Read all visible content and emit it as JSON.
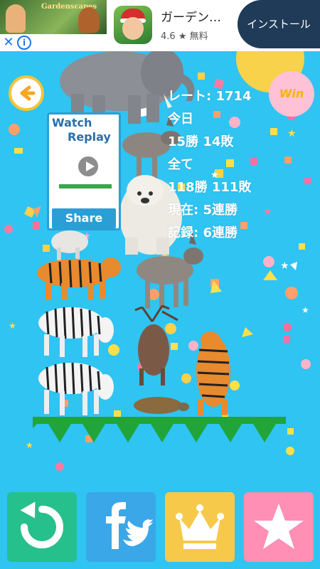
{
  "ad": {
    "thumb_title": "Gardenscapes",
    "app_title": "ガーデン…",
    "rating": "4.6",
    "rating_star": "★",
    "price": "無料",
    "install_label": "インストール",
    "close_glyph": "✕",
    "info_glyph": "i"
  },
  "game": {
    "back_icon": "arrow-left-icon",
    "replay": {
      "title_line1": "Watch",
      "title_line2": "Replay",
      "share_label": "Share"
    },
    "win_badge": "Win",
    "stats": {
      "rate": "レート: 1714",
      "today_label": "今日",
      "today_record": "15勝 14敗",
      "all_label": "全て",
      "all_record": "118勝 111敗",
      "current_streak": "現在: 5連勝",
      "best_streak": "記録: 6連勝"
    }
  },
  "bottom_bar": {
    "buttons": [
      {
        "icon": "retry-icon",
        "color": "#25c08c"
      },
      {
        "icon": "facebook-twitter-icon",
        "color": "#3aa7e8"
      },
      {
        "icon": "crown-icon",
        "color": "#f7c94a"
      },
      {
        "icon": "star-icon",
        "color": "#ff8fb4"
      }
    ]
  },
  "colors": {
    "background": "#2fc4f2",
    "ground": "#21a53b",
    "stat_text": "#ffffff"
  }
}
